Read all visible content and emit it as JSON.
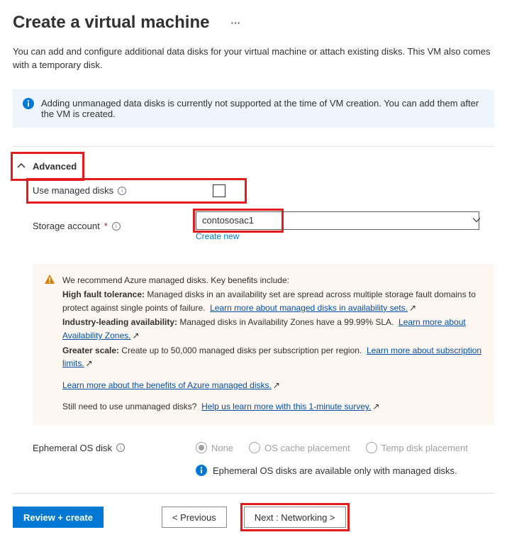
{
  "title": "Create a virtual machine",
  "intro": "You can add and configure additional data disks for your virtual machine or attach existing disks. This VM also comes with a temporary disk.",
  "info_alert": "Adding unmanaged data disks is currently not supported at the time of VM creation. You can add them after the VM is created.",
  "advanced": {
    "label": "Advanced",
    "managed_label": "Use managed disks",
    "managed_checked": false,
    "storage_label": "Storage account",
    "storage_value": "contososac1",
    "create_new": "Create new"
  },
  "warn": {
    "line1": "We recommend Azure managed disks.  Key benefits include:",
    "hft_label": "High fault tolerance:",
    "hft_text": "Managed disks in an availability set are spread across multiple storage fault domains to protect against single points of failure.",
    "hft_link": "Learn more about managed disks in availability sets.",
    "ila_label": "Industry-leading availability:",
    "ila_text": "Managed disks in Availability Zones have a 99.99% SLA.",
    "ila_link": "Learn more about Availability Zones.",
    "gs_label": "Greater scale:",
    "gs_text": "Create up to 50,000 managed disks per subscription per region.",
    "gs_link": "Learn more about subscription limits.",
    "benefits_link": "Learn more about the benefits of Azure managed disks.",
    "survey_text": "Still need to use unmanaged disks?",
    "survey_link": "Help us learn more with this 1-minute survey."
  },
  "ephemeral": {
    "label": "Ephemeral OS disk",
    "options": {
      "none": "None",
      "os_cache": "OS cache placement",
      "temp": "Temp disk placement"
    },
    "note": "Ephemeral OS disks are available only with managed disks."
  },
  "footer": {
    "review": "Review + create",
    "previous": "< Previous",
    "next": "Next : Networking >"
  }
}
